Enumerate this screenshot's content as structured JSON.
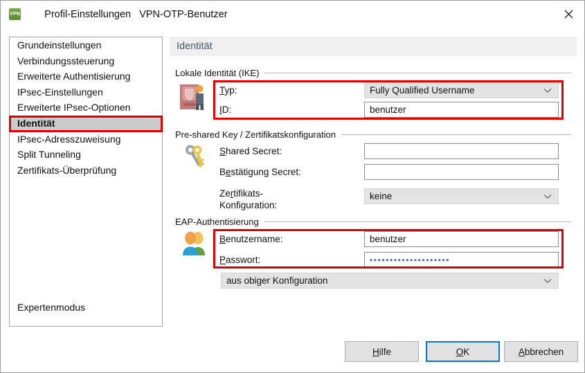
{
  "window": {
    "app_icon_label": "VPN",
    "title": "Profil-Einstellungen",
    "subtitle": "VPN-OTP-Benutzer",
    "close_icon": "close-icon",
    "accent_color": "#0078d7",
    "annotation_color": "#e00000"
  },
  "sidebar": {
    "items": [
      {
        "label": "Grundeinstellungen",
        "selected": false
      },
      {
        "label": "Verbindungssteuerung",
        "selected": false
      },
      {
        "label": "Erweiterte Authentisierung",
        "selected": false
      },
      {
        "label": "IPsec-Einstellungen",
        "selected": false
      },
      {
        "label": "Erweiterte IPsec-Optionen",
        "selected": false
      },
      {
        "label": "Identität",
        "selected": true
      },
      {
        "label": "IPsec-Adresszuweisung",
        "selected": false
      },
      {
        "label": "Split Tunneling",
        "selected": false
      },
      {
        "label": "Zertifikats-Überprüfung",
        "selected": false
      }
    ],
    "expert_mode": "Expertenmodus"
  },
  "content": {
    "header": "Identität",
    "groups": [
      {
        "title": "Lokale Identität (IKE)",
        "icon": "id-card-icon",
        "rows": [
          {
            "label_prefix": "",
            "label_accel": "T",
            "label_suffix": "yp:",
            "control": "combo",
            "value": "Fully Qualified Username"
          },
          {
            "label_prefix": "",
            "label_accel": "I",
            "label_suffix": "D:",
            "control": "text",
            "value": "benutzer"
          }
        ]
      },
      {
        "title": "Pre-shared Key / Zertifikatskonfiguration",
        "icon": "keys-icon",
        "rows": [
          {
            "label_prefix": "",
            "label_accel": "S",
            "label_suffix": "hared Secret:",
            "control": "text",
            "value": ""
          },
          {
            "label_prefix": "B",
            "label_accel": "e",
            "label_suffix": "stätigung Secret:",
            "control": "text",
            "value": ""
          },
          {
            "label_prefix": "Ze",
            "label_accel": "r",
            "label_suffix": "tifikats-",
            "label_line2": "Konfiguration:",
            "control": "combo",
            "value": "keine"
          }
        ]
      },
      {
        "title": "EAP-Authentisierung",
        "icon": "users-icon",
        "rows": [
          {
            "label_prefix": "",
            "label_accel": "B",
            "label_suffix": "enutzername:",
            "control": "text",
            "value": "benutzer"
          },
          {
            "label_prefix": "",
            "label_accel": "P",
            "label_suffix": "asswort:",
            "control": "password",
            "value": "••••••••••••••••••••"
          }
        ],
        "extra_combo": "aus obiger Konfiguration"
      }
    ]
  },
  "footer": {
    "help": {
      "prefix": "",
      "accel": "H",
      "suffix": "ilfe"
    },
    "ok": {
      "prefix": "",
      "accel": "O",
      "suffix": "K"
    },
    "cancel": {
      "prefix": "",
      "accel": "A",
      "suffix": "bbrechen"
    }
  }
}
